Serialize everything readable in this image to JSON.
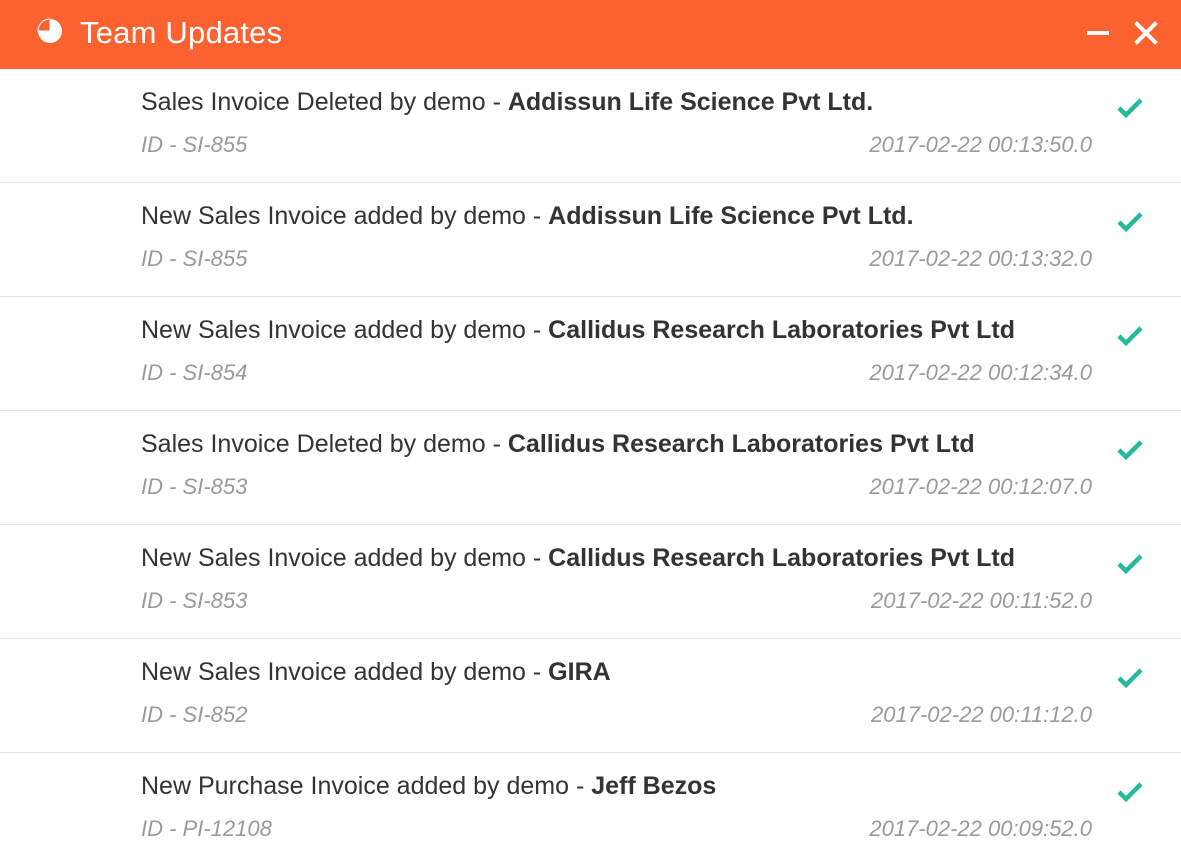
{
  "window": {
    "title": "Team Updates",
    "accent_color": "#fb6230",
    "check_color": "#26b99a",
    "icons": {
      "app": "pie-chart-icon",
      "minimize": "minimize-icon",
      "close": "close-icon",
      "read": "checkmark-icon"
    }
  },
  "updates": [
    {
      "message": "Sales Invoice Deleted by demo - ",
      "party": "Addissun Life Science Pvt Ltd.",
      "ref": "ID - SI-855",
      "timestamp": "2017-02-22 00:13:50.0"
    },
    {
      "message": "New Sales Invoice added by demo - ",
      "party": "Addissun Life Science Pvt Ltd.",
      "ref": "ID - SI-855",
      "timestamp": "2017-02-22 00:13:32.0"
    },
    {
      "message": "New Sales Invoice added by demo - ",
      "party": "Callidus Research Laboratories Pvt Ltd",
      "ref": "ID - SI-854",
      "timestamp": "2017-02-22 00:12:34.0"
    },
    {
      "message": "Sales Invoice Deleted by demo - ",
      "party": "Callidus Research Laboratories Pvt Ltd",
      "ref": "ID - SI-853",
      "timestamp": "2017-02-22 00:12:07.0"
    },
    {
      "message": "New Sales Invoice added by demo - ",
      "party": "Callidus Research Laboratories Pvt Ltd",
      "ref": "ID - SI-853",
      "timestamp": "2017-02-22 00:11:52.0"
    },
    {
      "message": "New Sales Invoice added by demo - ",
      "party": "GIRA",
      "ref": "ID - SI-852",
      "timestamp": "2017-02-22 00:11:12.0"
    },
    {
      "message": "New Purchase Invoice added by demo - ",
      "party": "Jeff Bezos",
      "ref": "ID - PI-12108",
      "timestamp": "2017-02-22 00:09:52.0"
    }
  ]
}
